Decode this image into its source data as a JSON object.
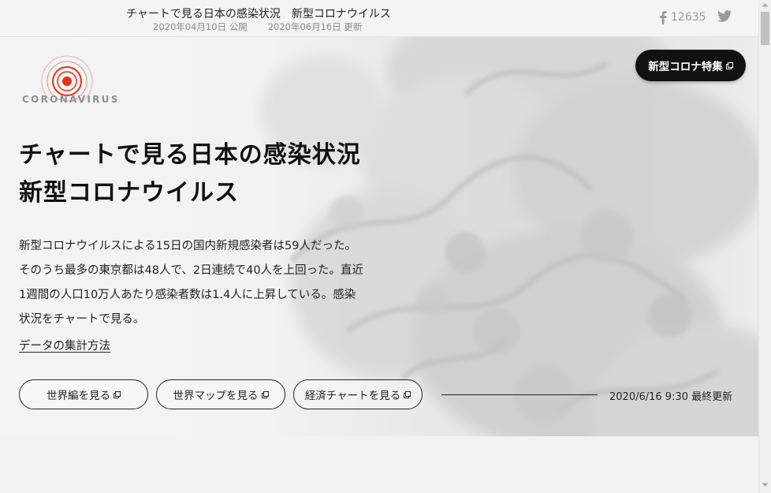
{
  "topbar": {
    "title": "チャートで見る日本の感染状況　新型コロナウイルス",
    "published": "2020年04月10日 公開",
    "updated": "2020年06月16日 更新",
    "facebook_count": "12635",
    "icons": [
      "facebook-icon",
      "twitter-icon"
    ]
  },
  "logo": {
    "text": "CORONAVIRUS"
  },
  "special_button": {
    "label": "新型コロナ特集"
  },
  "headline": {
    "line1": "チャートで見る日本の感染状況",
    "line2": "新型コロナウイルス"
  },
  "lead": {
    "line1": "新型コロナウイルスによる15日の国内新規感染者は59人だった。",
    "line2": "そのうち最多の東京都は48人で、2日連続で40人を上回った。直近",
    "line3": "1週間の人口10万人あたり感染者数は1.4人に上昇している。感染",
    "line4": "状況をチャートで見る。"
  },
  "method_link": "データの集計方法",
  "buttons": [
    {
      "label": "世界編を見る"
    },
    {
      "label": "世界マップを見る"
    },
    {
      "label": "経済チャートを見る"
    }
  ],
  "last_update": "2020/6/16 9:30 最終更新",
  "colors": {
    "accent": "#e5321b",
    "dark": "#111111",
    "background": "#f2f2f2"
  }
}
